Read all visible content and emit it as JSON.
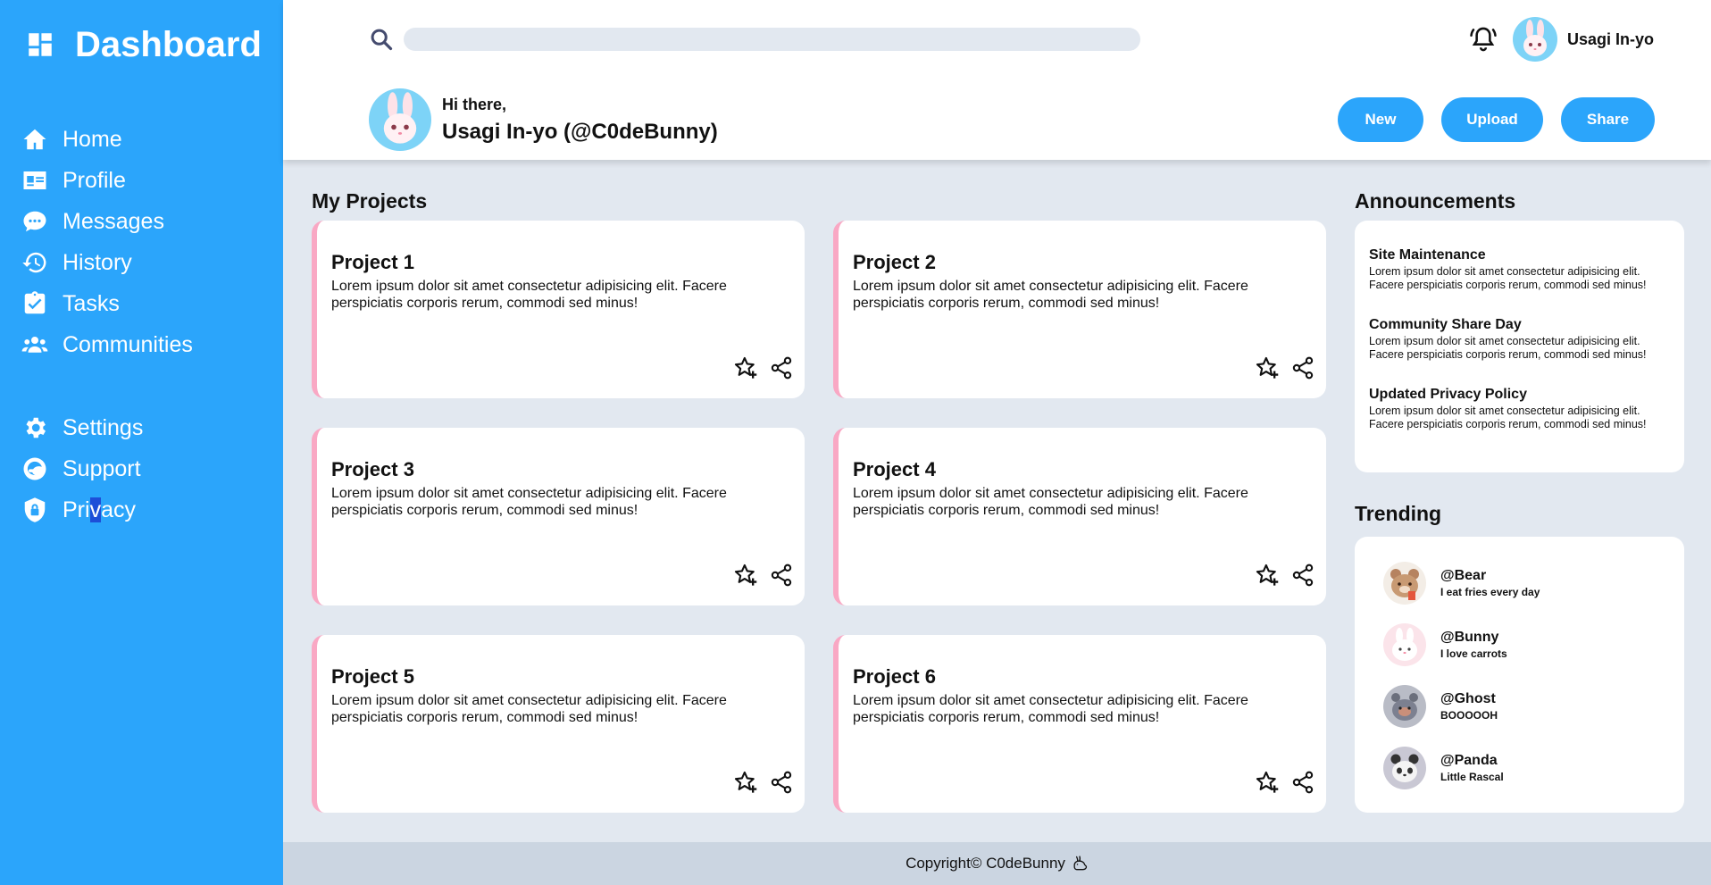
{
  "sidebar": {
    "brand": "Dashboard",
    "items": [
      {
        "label": "Home",
        "icon": "home-icon"
      },
      {
        "label": "Profile",
        "icon": "id-card-icon"
      },
      {
        "label": "Messages",
        "icon": "chat-icon"
      },
      {
        "label": "History",
        "icon": "history-icon"
      },
      {
        "label": "Tasks",
        "icon": "clipboard-check-icon"
      },
      {
        "label": "Communities",
        "icon": "users-icon"
      },
      {
        "label": "Settings",
        "icon": "gear-icon"
      },
      {
        "label": "Support",
        "icon": "support-icon"
      }
    ],
    "privacy": {
      "pre": "Pri",
      "sel": "v",
      "post": "acy",
      "icon": "shield-lock-icon"
    }
  },
  "header": {
    "search_placeholder": "",
    "user_name": "Usagi In-yo",
    "greeting": "Hi there,",
    "full_name": "Usagi In-yo (@C0deBunny)",
    "buttons": {
      "new": "New",
      "upload": "Upload",
      "share": "Share"
    }
  },
  "projects": {
    "title": "My Projects",
    "items": [
      {
        "title": "Project 1",
        "desc": "Lorem ipsum dolor sit amet consectetur adipisicing elit. Facere perspiciatis corporis rerum, commodi sed minus!"
      },
      {
        "title": "Project 2",
        "desc": "Lorem ipsum dolor sit amet consectetur adipisicing elit. Facere perspiciatis corporis rerum, commodi sed minus!"
      },
      {
        "title": "Project 3",
        "desc": "Lorem ipsum dolor sit amet consectetur adipisicing elit. Facere perspiciatis corporis rerum, commodi sed minus!"
      },
      {
        "title": "Project 4",
        "desc": "Lorem ipsum dolor sit amet consectetur adipisicing elit. Facere perspiciatis corporis rerum, commodi sed minus!"
      },
      {
        "title": "Project 5",
        "desc": "Lorem ipsum dolor sit amet consectetur adipisicing elit. Facere perspiciatis corporis rerum, commodi sed minus!"
      },
      {
        "title": "Project 6",
        "desc": "Lorem ipsum dolor sit amet consectetur adipisicing elit. Facere perspiciatis corporis rerum, commodi sed minus!"
      }
    ]
  },
  "announcements": {
    "title": "Announcements",
    "items": [
      {
        "title": "Site Maintenance",
        "body": "Lorem ipsum dolor sit amet consectetur adipisicing elit. Facere perspiciatis corporis rerum, commodi sed minus!"
      },
      {
        "title": "Community Share Day",
        "body": "Lorem ipsum dolor sit amet consectetur adipisicing elit. Facere perspiciatis corporis rerum, commodi sed minus!"
      },
      {
        "title": "Updated Privacy Policy",
        "body": "Lorem ipsum dolor sit amet consectetur adipisicing elit. Facere perspiciatis corporis rerum, commodi sed minus!"
      }
    ]
  },
  "trending": {
    "title": "Trending",
    "items": [
      {
        "handle": "@Bear",
        "sub": "I eat fries every day"
      },
      {
        "handle": "@Bunny",
        "sub": "I love carrots"
      },
      {
        "handle": "@Ghost",
        "sub": "BOOOOOH"
      },
      {
        "handle": "@Panda",
        "sub": "Little Rascal"
      }
    ]
  },
  "footer": {
    "text": "Copyright© C0deBunny",
    "icon": "bunny-icon"
  },
  "colors": {
    "accent": "#2ba5fb",
    "card_border": "#f9a8c4",
    "background": "#e2e8f0"
  }
}
